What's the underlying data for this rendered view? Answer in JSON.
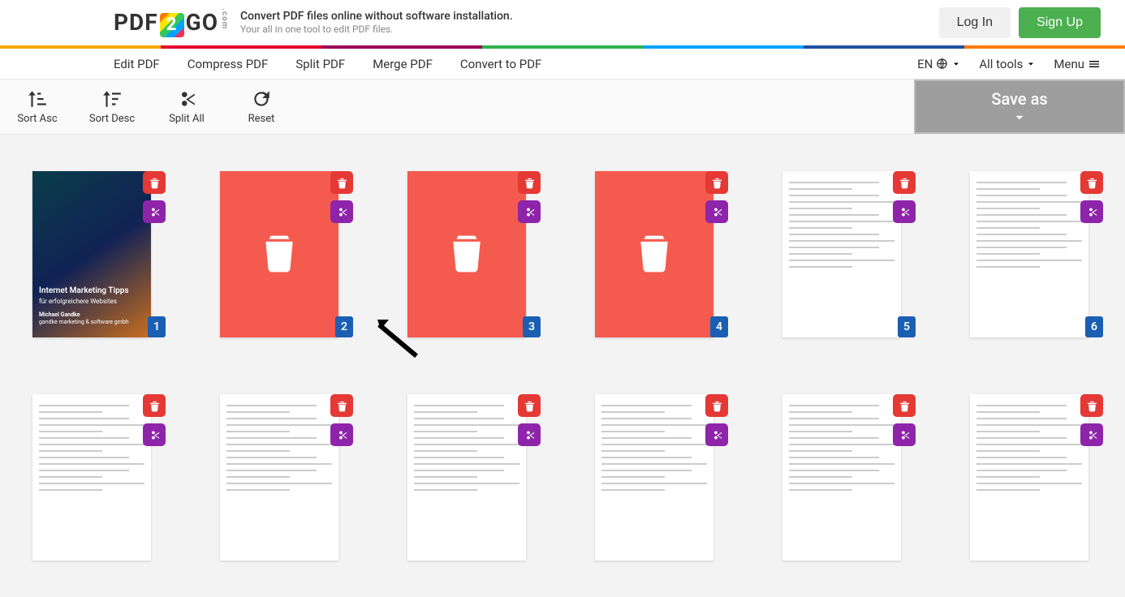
{
  "brand": {
    "pdf": "PDF",
    "go": "GO",
    "two": "2",
    "dotcom": ".com"
  },
  "tagline": {
    "line1": "Convert PDF files online without software installation.",
    "line2": "Your all in one tool to edit PDF files."
  },
  "auth": {
    "login": "Log In",
    "signup": "Sign Up"
  },
  "nav": {
    "edit": "Edit PDF",
    "compress": "Compress PDF",
    "split": "Split PDF",
    "merge": "Merge PDF",
    "convert": "Convert to PDF",
    "lang": "EN",
    "alltools": "All tools",
    "menu": "Menu"
  },
  "toolbar": {
    "sort_asc": "Sort Asc",
    "sort_desc": "Sort Desc",
    "split_all": "Split All",
    "reset": "Reset",
    "save_as": "Save as"
  },
  "cover": {
    "title": "Internet Marketing Tipps",
    "sub": "für erfolgreichere Websites",
    "author": "Michael Gandke",
    "company": "gandke marketing & software gmbh"
  },
  "pages_row1": [
    {
      "n": "1",
      "state": "cover"
    },
    {
      "n": "2",
      "state": "deleted"
    },
    {
      "n": "3",
      "state": "deleted"
    },
    {
      "n": "4",
      "state": "deleted"
    },
    {
      "n": "5",
      "state": "doc"
    },
    {
      "n": "6",
      "state": "doc"
    }
  ],
  "pages_row2": [
    {
      "state": "doc"
    },
    {
      "state": "doc"
    },
    {
      "state": "doc"
    },
    {
      "state": "doc"
    },
    {
      "state": "doc"
    },
    {
      "state": "doc"
    }
  ],
  "icons": {
    "trash": "trash-icon",
    "scissors": "scissors-icon"
  }
}
